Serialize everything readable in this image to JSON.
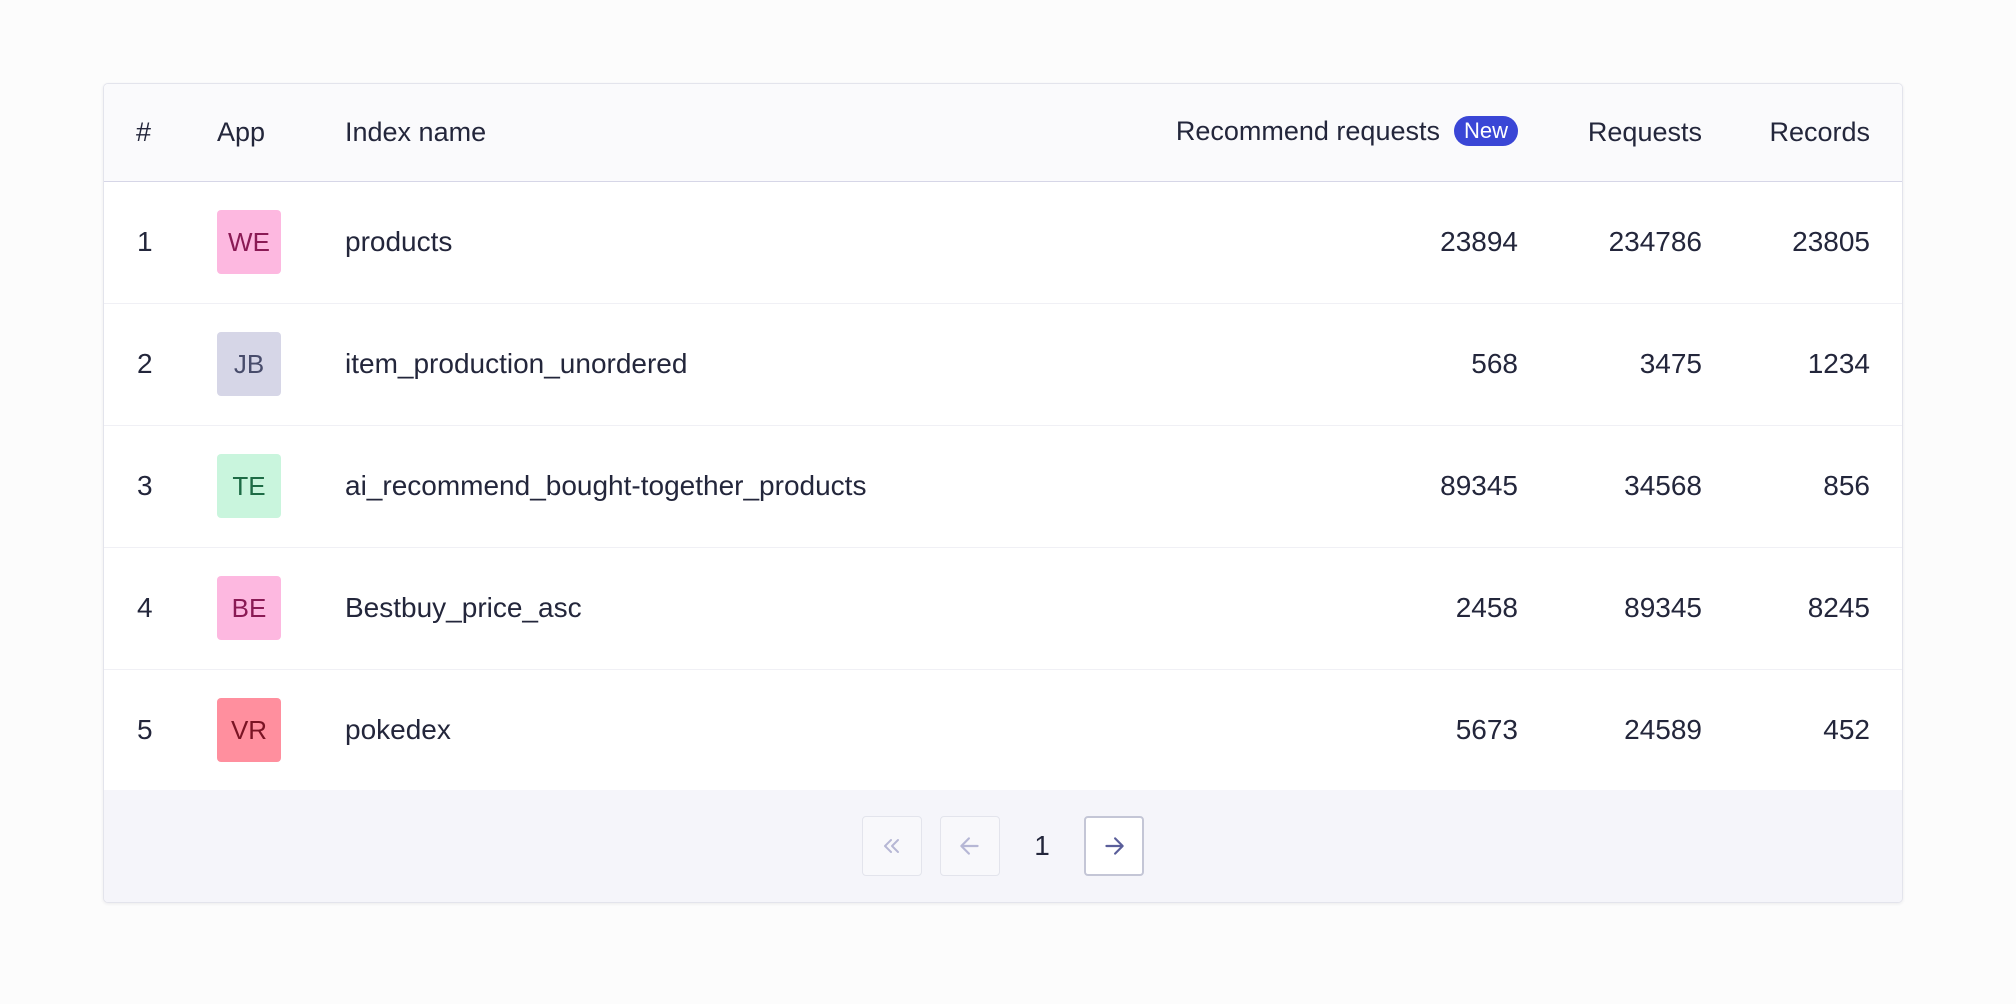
{
  "table": {
    "headers": {
      "num": "#",
      "app": "App",
      "index_name": "Index name",
      "recommend_requests": "Recommend requests",
      "new_badge": "New",
      "requests": "Requests",
      "records": "Records"
    },
    "rows": [
      {
        "num": "1",
        "app": "WE",
        "app_bg": "#fdb8e0",
        "app_fg": "#8a1a55",
        "index_name": "products",
        "recommend_requests": "23894",
        "requests": "234786",
        "records": "23805"
      },
      {
        "num": "2",
        "app": "JB",
        "app_bg": "#d6d6e7",
        "app_fg": "#484c6b",
        "index_name": "item_production_unordered",
        "recommend_requests": "568",
        "requests": "3475",
        "records": "1234"
      },
      {
        "num": "3",
        "app": "TE",
        "app_bg": "#c9f5dd",
        "app_fg": "#1d6b45",
        "index_name": "ai_recommend_bought-together_products",
        "recommend_requests": "89345",
        "requests": "34568",
        "records": "856"
      },
      {
        "num": "4",
        "app": "BE",
        "app_bg": "#fdb8e0",
        "app_fg": "#8a1a55",
        "index_name": "Bestbuy_price_asc",
        "recommend_requests": "2458",
        "requests": "89345",
        "records": "8245"
      },
      {
        "num": "5",
        "app": "VR",
        "app_bg": "#ff8f9e",
        "app_fg": "#7a1424",
        "index_name": "pokedex",
        "recommend_requests": "5673",
        "requests": "24589",
        "records": "452"
      }
    ]
  },
  "pagination": {
    "current_page": "1",
    "first_icon": "double-chevron-left-icon",
    "prev_icon": "arrow-left-icon",
    "next_icon": "arrow-right-icon"
  },
  "colors": {
    "accent": "#3a46d6",
    "text": "#23263b",
    "border": "#d6d6e7"
  }
}
